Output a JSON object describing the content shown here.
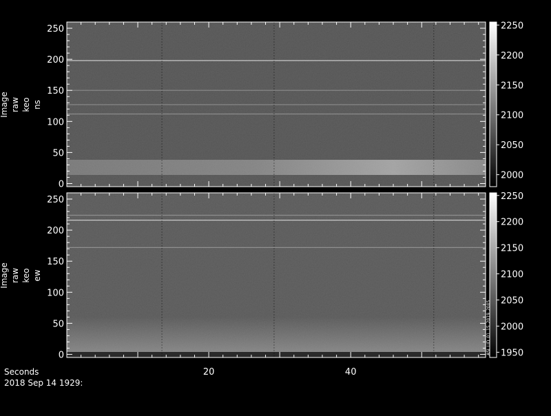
{
  "chart_data": [
    {
      "type": "heatmap",
      "ylabel": [
        "Image",
        "raw",
        "keo",
        "ns"
      ],
      "y_ticks": [
        0,
        50,
        100,
        150,
        200,
        250
      ],
      "ylim": [
        -5,
        260
      ],
      "colorbar": {
        "ticks": [
          2000,
          2050,
          2100,
          2150,
          2200,
          2250
        ],
        "range": [
          1980,
          2255
        ]
      },
      "bright_lines_y": [
        198,
        150,
        127,
        112
      ],
      "band": {
        "y_center_start": 26,
        "y_center_end": 20,
        "peak_x_fraction": 0.75
      },
      "dark_columns_x": [
        13.4,
        29.2,
        51.7
      ]
    },
    {
      "type": "heatmap",
      "ylabel": [
        "Image",
        "raw",
        "keo",
        "ew"
      ],
      "y_ticks": [
        0,
        50,
        100,
        150,
        200,
        250
      ],
      "ylim": [
        -5,
        260
      ],
      "colorbar": {
        "ticks": [
          1950,
          2000,
          2050,
          2100,
          2150,
          2200,
          2250
        ],
        "range": [
          1940,
          2255
        ]
      },
      "bright_lines_y": [
        216,
        224,
        172
      ],
      "dark_columns_x": [
        13.4,
        29.2,
        51.7
      ],
      "annotation": "ASI_LID_01_15_2019_2005"
    }
  ],
  "x_axis": {
    "label": "Seconds",
    "ticks": [
      20,
      40
    ],
    "xlim": [
      0,
      59
    ]
  },
  "date_label": "2018 Sep 14 1929:"
}
